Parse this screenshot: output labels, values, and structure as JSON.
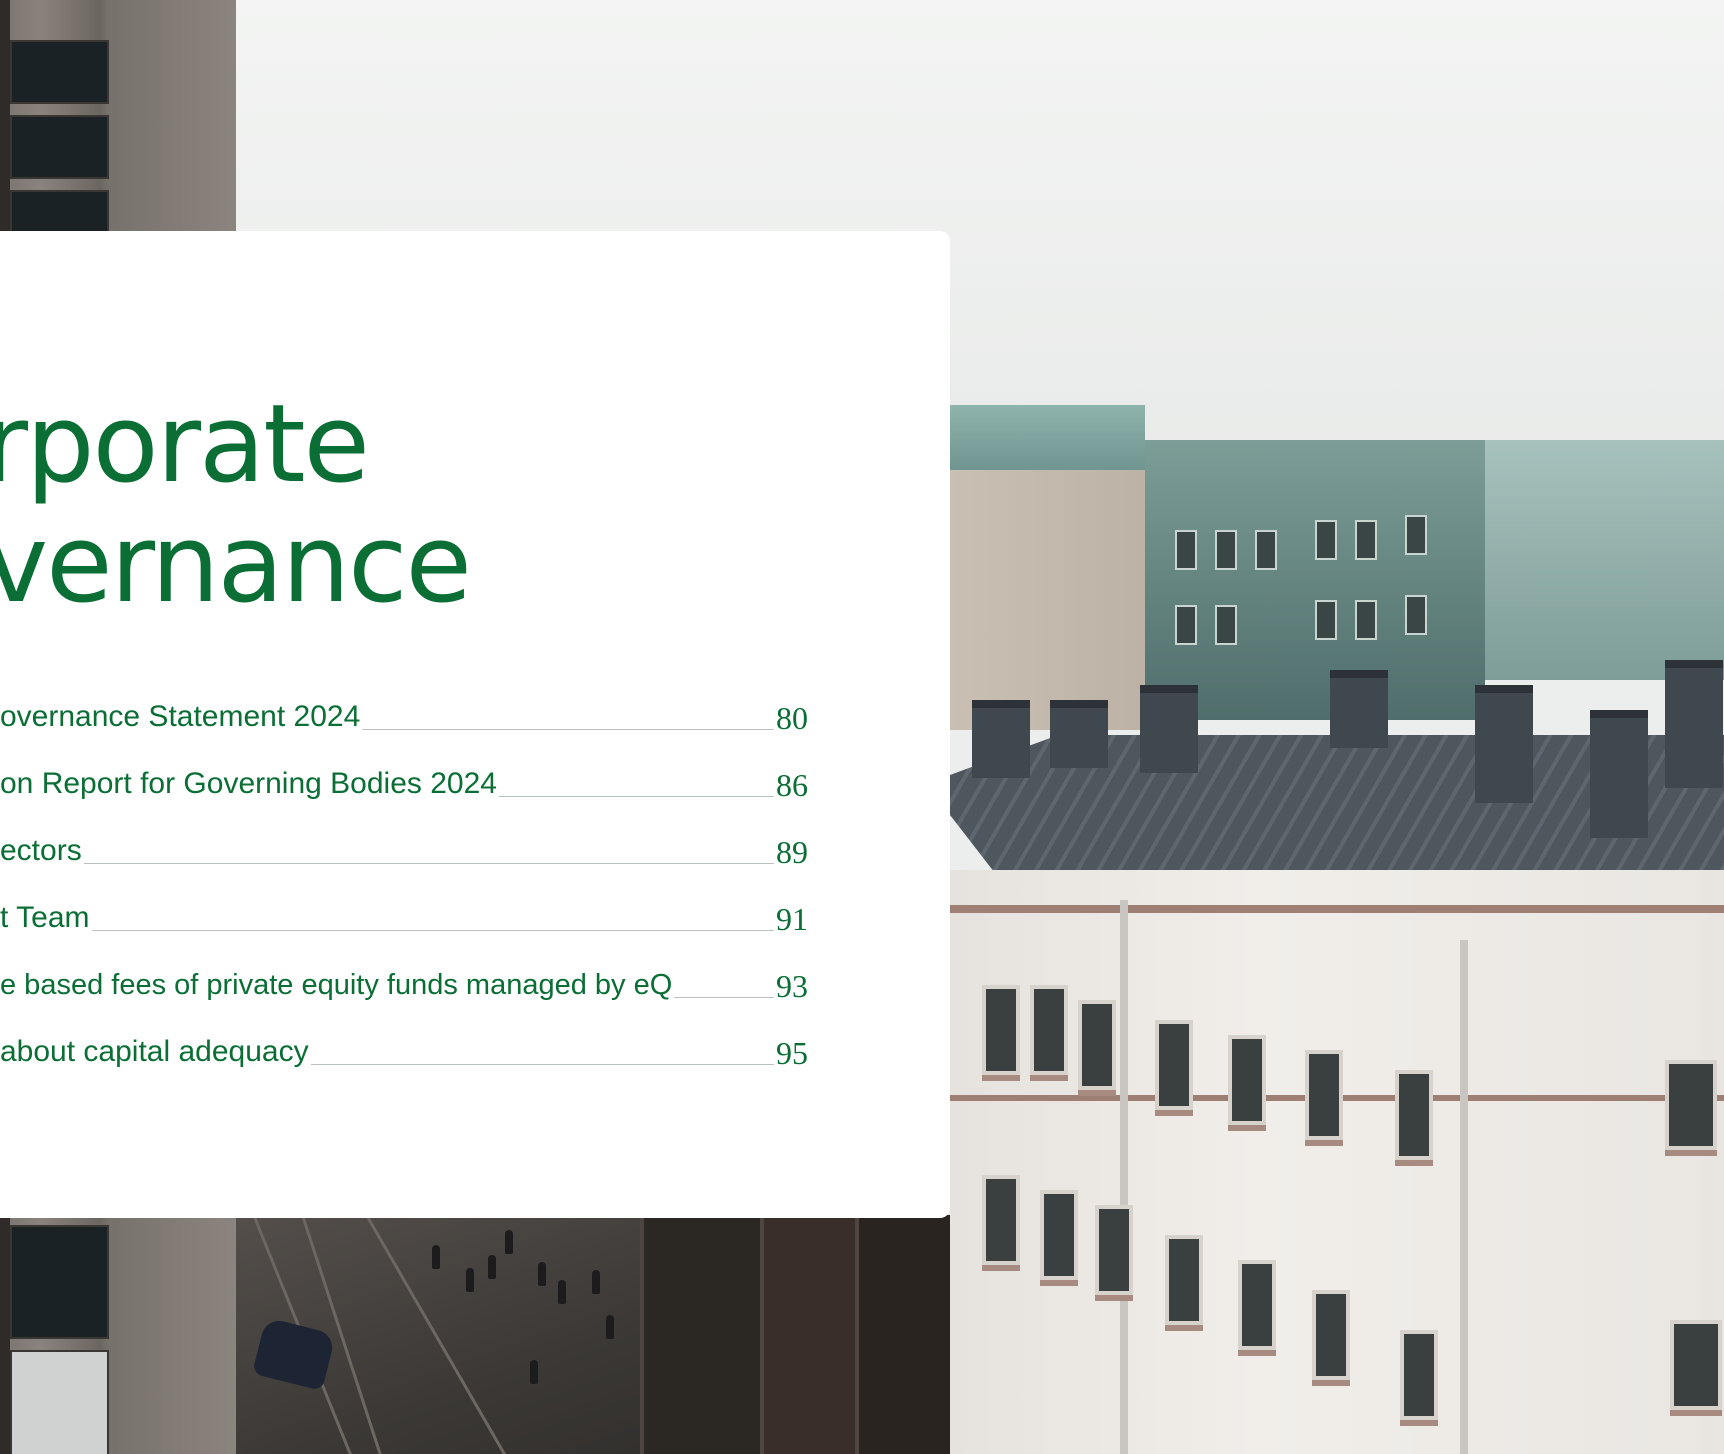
{
  "section": {
    "title_line_1": "rporate",
    "title_line_2": "vernance"
  },
  "toc": [
    {
      "label": "overnance Statement 2024",
      "page": "80"
    },
    {
      "label": "on Report for Governing Bodies 2024",
      "page": "86"
    },
    {
      "label": "ectors",
      "page": "89"
    },
    {
      "label": "t Team",
      "page": "91"
    },
    {
      "label": "e based fees of private equity funds managed by eQ",
      "page": "93"
    },
    {
      "label": "about capital adequacy",
      "page": "95"
    }
  ],
  "colors": {
    "accent_green": "#0a6e35",
    "card_background": "#ffffff",
    "leader_line": "#b9c2bd"
  }
}
